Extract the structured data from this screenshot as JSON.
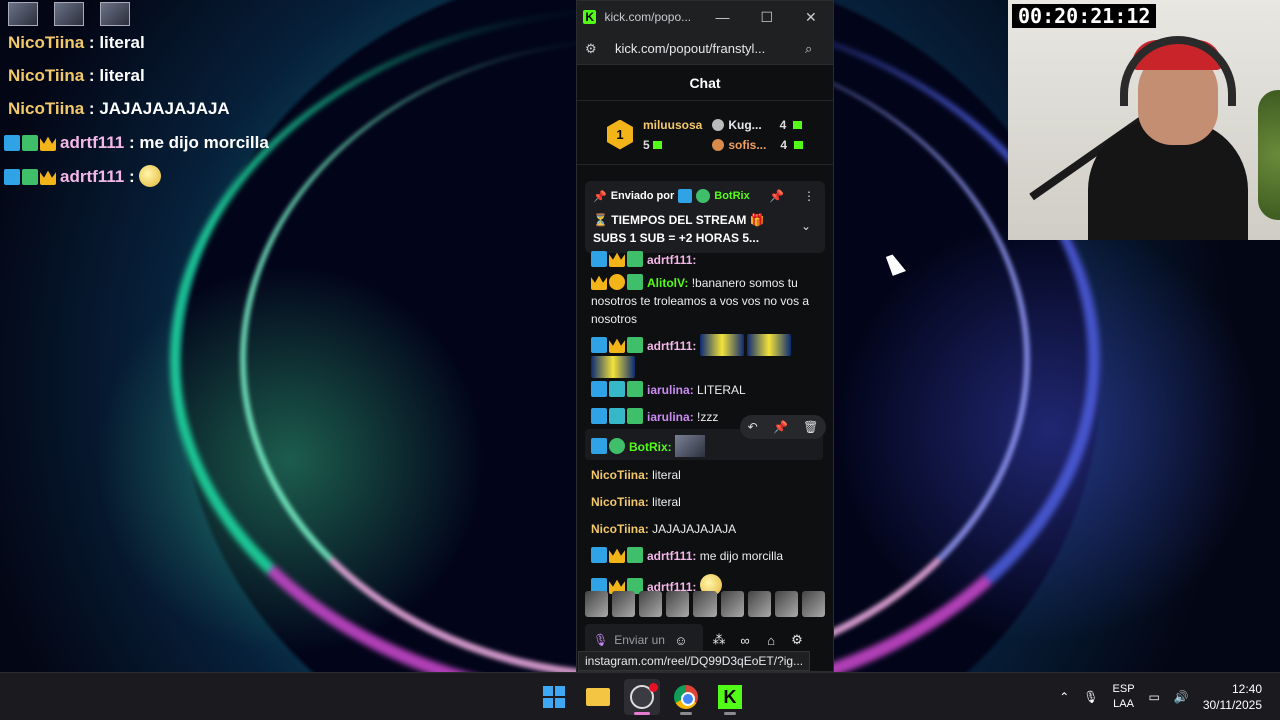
{
  "overlay": {
    "messages": [
      {
        "name": "NicoTiina",
        "sep": " : ",
        "text": "literal"
      },
      {
        "name": "NicoTiina",
        "sep": " : ",
        "text": "literal"
      },
      {
        "name": "NicoTiina",
        "sep": " : ",
        "text": "JAJAJAJAJAJA"
      },
      {
        "name": "adrtf111",
        "sep": " : ",
        "text": "me dijo morcilla"
      },
      {
        "name": "adrtf111",
        "sep": " : ",
        "text": ""
      }
    ]
  },
  "browser": {
    "title": "kick.com/popo...",
    "address": "kick.com/popout/franstyl...",
    "status_url": "instagram.com/reel/DQ99D3qEoET/?ig..."
  },
  "chat": {
    "header": "Chat",
    "leaderboard": {
      "first": {
        "rank": "1",
        "name": "miluusosa",
        "count": "5"
      },
      "second": {
        "name": "Kug...",
        "count": "4"
      },
      "third": {
        "name": "sofis...",
        "count": "4"
      }
    },
    "pinned": {
      "label": "Enviado por",
      "by": "BotRix",
      "text": "⏳ TIEMPOS DEL STREAM 🎁 SUBS 1 SUB = +2 HORAS 5..."
    },
    "messages": [
      {
        "name": "adrtf111",
        "sep": ":",
        "text": ""
      },
      {
        "name": "AlitolV",
        "sep": ":",
        "text": "!bananero somos tu nosotros te troleamos a vos vos no vos a nosotros"
      },
      {
        "name": "adrtf111",
        "sep": ":",
        "text": ""
      },
      {
        "name": "iarulina",
        "sep": ":",
        "text": "LITERAL"
      },
      {
        "name": "iarulina",
        "sep": ":",
        "text": "!zzz"
      },
      {
        "name": "BotRix",
        "sep": ":",
        "text": ""
      },
      {
        "name": "NicoTiina",
        "sep": ":",
        "text": "literal"
      },
      {
        "name": "NicoTiina",
        "sep": ":",
        "text": "literal"
      },
      {
        "name": "NicoTiina",
        "sep": ":",
        "text": "JAJAJAJAJAJA"
      },
      {
        "name": "adrtf111",
        "sep": ":",
        "text": "me dijo morcilla"
      },
      {
        "name": "adrtf111",
        "sep": ":",
        "text": ""
      }
    ],
    "composer_placeholder": "Enviar un"
  },
  "webcam": {
    "timer": "00:20:21:12"
  },
  "taskbar": {
    "lang_top": "ESP",
    "lang_bottom": "LAA",
    "time": "12:40",
    "date": "30/11/2025"
  },
  "colors": {
    "kick_green": "#53fc18",
    "accent_pink": "#e67bd3"
  }
}
